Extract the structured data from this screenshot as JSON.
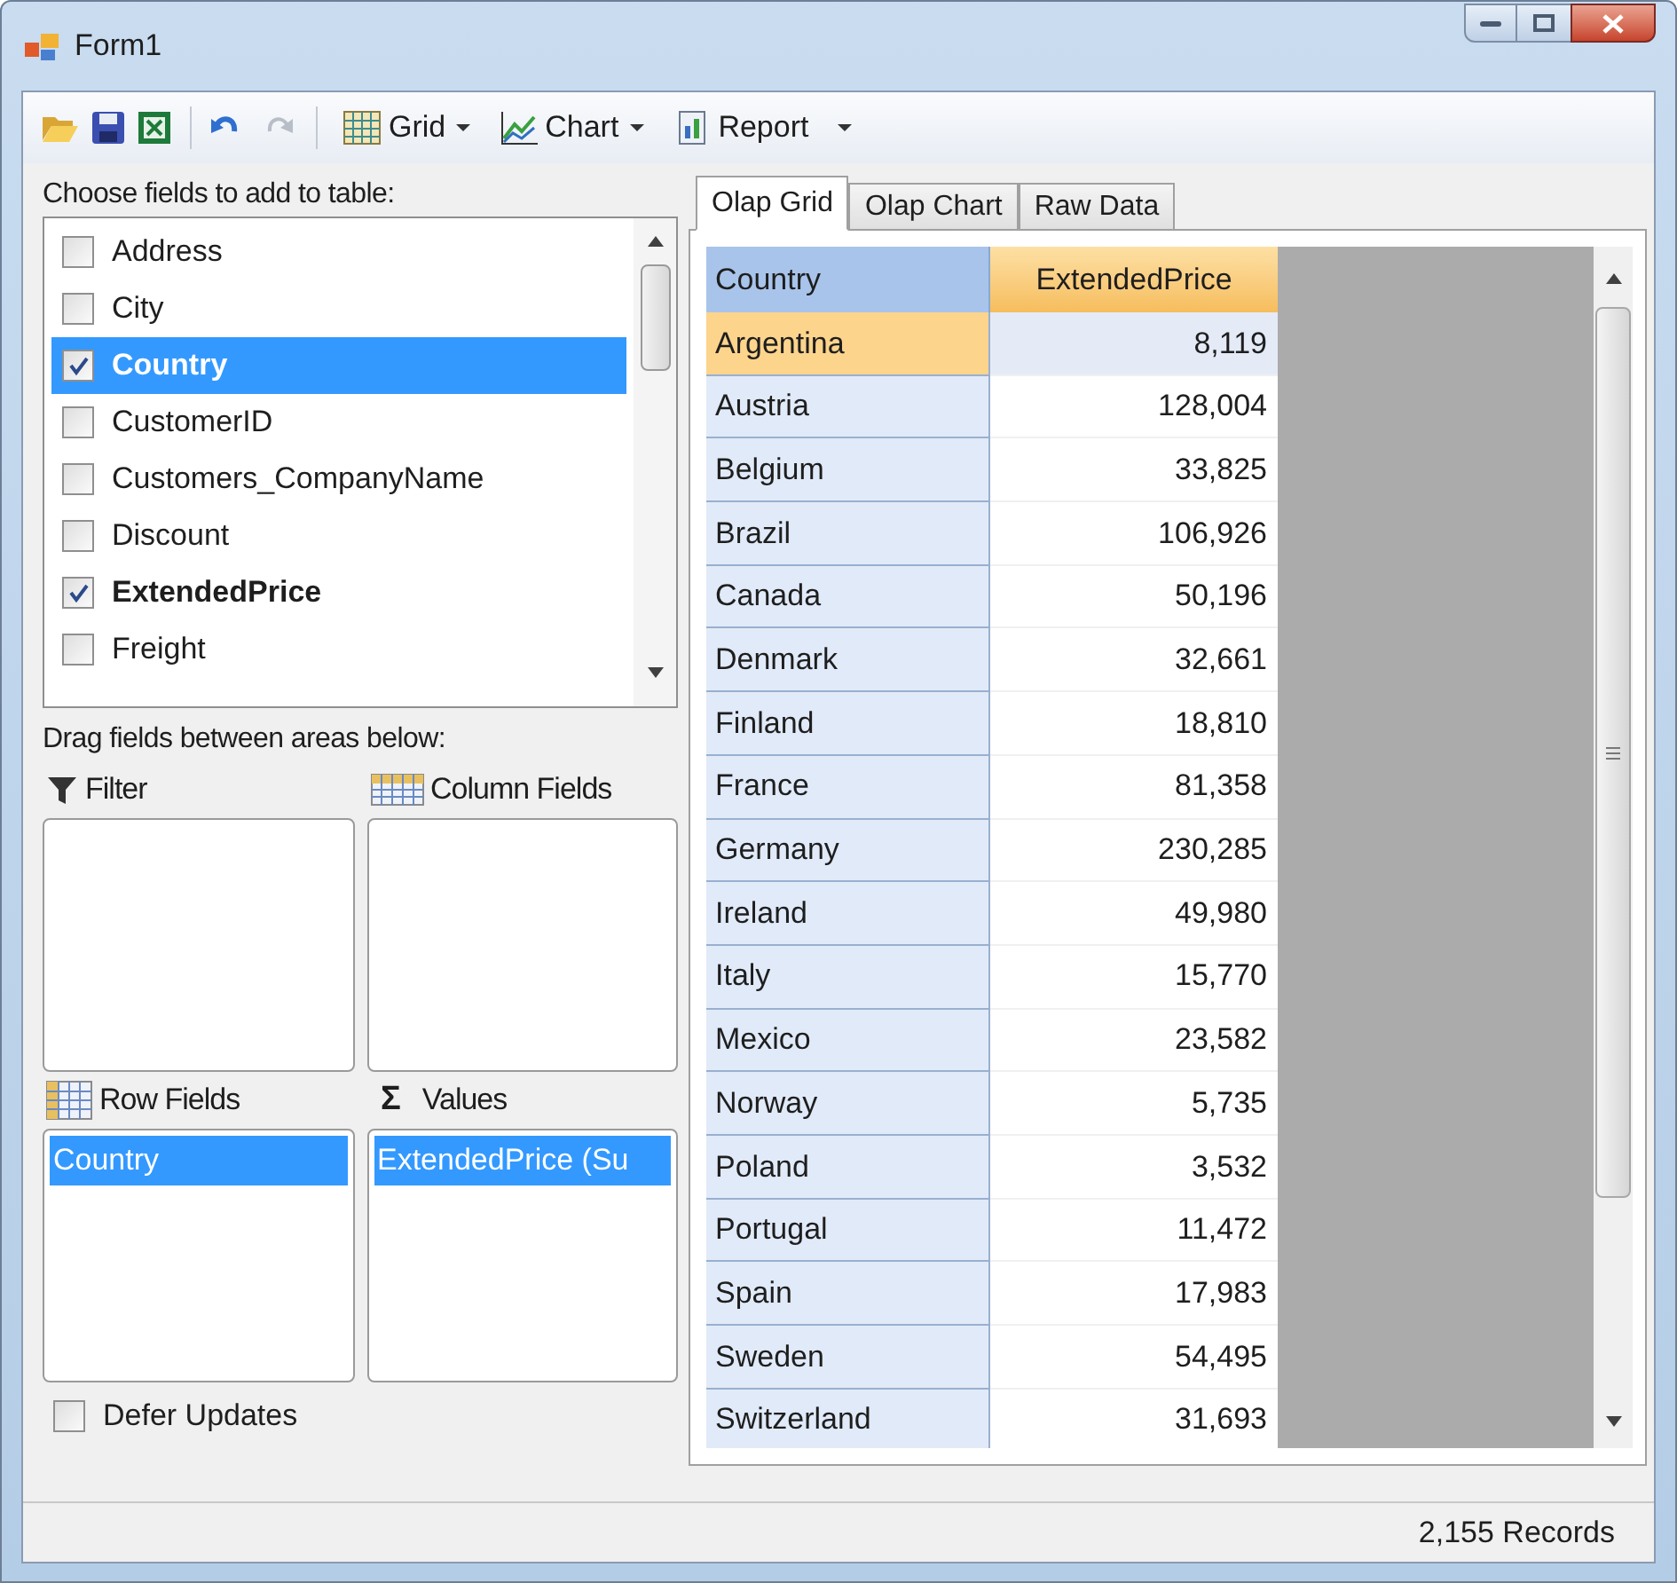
{
  "window": {
    "title": "Form1"
  },
  "toolbar": {
    "redo": {
      "disabled": true
    },
    "views": [
      {
        "kind": "grid",
        "label": "Grid"
      },
      {
        "kind": "chart",
        "label": "Chart"
      },
      {
        "kind": "report",
        "label": "Report"
      }
    ]
  },
  "field_list": {
    "label": "Choose fields to add to table:",
    "items": [
      {
        "label": "Address",
        "checked": false,
        "selected": false
      },
      {
        "label": "City",
        "checked": false,
        "selected": false
      },
      {
        "label": "Country",
        "checked": true,
        "selected": true
      },
      {
        "label": "CustomerID",
        "checked": false,
        "selected": false
      },
      {
        "label": "Customers_CompanyName",
        "checked": false,
        "selected": false
      },
      {
        "label": "Discount",
        "checked": false,
        "selected": false
      },
      {
        "label": "ExtendedPrice",
        "checked": true,
        "selected": false
      },
      {
        "label": "Freight",
        "checked": false,
        "selected": false
      }
    ]
  },
  "drag_label": "Drag fields between areas below:",
  "areas": [
    {
      "kind": "filter",
      "label": "Filter"
    },
    {
      "kind": "columns",
      "label": "Column Fields"
    },
    {
      "kind": "rows",
      "label": "Row Fields",
      "items": [
        {
          "label": "Country",
          "selected": true
        }
      ]
    },
    {
      "kind": "values",
      "label": "Values",
      "symbol": "Σ",
      "items": [
        {
          "label": "ExtendedPrice (Su",
          "selected": true
        }
      ]
    }
  ],
  "defer_updates": {
    "label": "Defer Updates",
    "checked": false
  },
  "tabs": [
    {
      "label": "Olap Grid",
      "selected": true
    },
    {
      "label": "Olap Chart",
      "selected": false
    },
    {
      "label": "Raw Data",
      "selected": false
    }
  ],
  "grid": {
    "columns": [
      "Country",
      "ExtendedPrice"
    ],
    "rows": [
      {
        "country": "Argentina",
        "value": "8,119",
        "selected": true
      },
      {
        "country": "Austria",
        "value": "128,004",
        "selected": false
      },
      {
        "country": "Belgium",
        "value": "33,825",
        "selected": false
      },
      {
        "country": "Brazil",
        "value": "106,926",
        "selected": false
      },
      {
        "country": "Canada",
        "value": "50,196",
        "selected": false
      },
      {
        "country": "Denmark",
        "value": "32,661",
        "selected": false
      },
      {
        "country": "Finland",
        "value": "18,810",
        "selected": false
      },
      {
        "country": "France",
        "value": "81,358",
        "selected": false
      },
      {
        "country": "Germany",
        "value": "230,285",
        "selected": false
      },
      {
        "country": "Ireland",
        "value": "49,980",
        "selected": false
      },
      {
        "country": "Italy",
        "value": "15,770",
        "selected": false
      },
      {
        "country": "Mexico",
        "value": "23,582",
        "selected": false
      },
      {
        "country": "Norway",
        "value": "5,735",
        "selected": false
      },
      {
        "country": "Poland",
        "value": "3,532",
        "selected": false
      },
      {
        "country": "Portugal",
        "value": "11,472",
        "selected": false
      },
      {
        "country": "Spain",
        "value": "17,983",
        "selected": false
      },
      {
        "country": "Sweden",
        "value": "54,495",
        "selected": false
      },
      {
        "country": "Switzerland",
        "value": "31,693",
        "selected": false
      }
    ]
  },
  "status_bar": {
    "records": "2,155 Records"
  }
}
